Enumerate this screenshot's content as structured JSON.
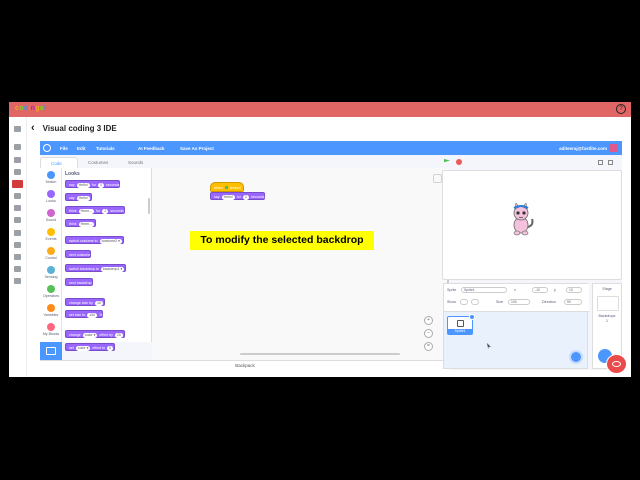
{
  "app": {
    "logo_text": "codingal",
    "logo_colors": [
      "#f5a623",
      "#7ed321",
      "#4a90e2",
      "#ff6f61",
      "#bd10e0"
    ],
    "page_title": "Visual coding 3 IDE",
    "topbar_color": "#e06666"
  },
  "menubar": {
    "items": [
      "File",
      "Edit",
      "Tutorials",
      "AI Feedback",
      "Save As Project"
    ],
    "user_email": "aditeeraj@fastlite.com",
    "accent": "#4c97ff"
  },
  "tabs": [
    "Code",
    "Costumes",
    "Sounds"
  ],
  "categories": [
    {
      "label": "Motion",
      "color": "#4c97ff"
    },
    {
      "label": "Looks",
      "color": "#9966ff"
    },
    {
      "label": "Sound",
      "color": "#cf63cf"
    },
    {
      "label": "Events",
      "color": "#ffbf00"
    },
    {
      "label": "Control",
      "color": "#ffab19"
    },
    {
      "label": "Sensing",
      "color": "#5cb1d6"
    },
    {
      "label": "Operators",
      "color": "#59c059"
    },
    {
      "label": "Variables",
      "color": "#ff8c1a"
    },
    {
      "label": "My Blocks",
      "color": "#ff6680"
    }
  ],
  "palette": {
    "title": "Looks",
    "blocks": [
      {
        "a": "say",
        "p1": "Hello!",
        "b": "for",
        "p2": "2",
        "c": "seconds"
      },
      {
        "a": "say",
        "p1": "Hello!",
        "b": "",
        "p2": "",
        "c": ""
      },
      {
        "a": "think",
        "p1": "Hmm...",
        "b": "for",
        "p2": "2",
        "c": "seconds"
      },
      {
        "a": "think",
        "p1": "Hmm...",
        "b": "",
        "p2": "",
        "c": ""
      },
      {
        "a": "switch costume to",
        "p1": "costume2 ▾",
        "b": "",
        "p2": "",
        "c": ""
      },
      {
        "a": "next costume",
        "p1": "",
        "b": "",
        "p2": "",
        "c": ""
      },
      {
        "a": "switch backdrop to",
        "p1": "backdrop1 ▾",
        "b": "",
        "p2": "",
        "c": ""
      },
      {
        "a": "next backdrop",
        "p1": "",
        "b": "",
        "p2": "",
        "c": ""
      },
      {
        "a": "change size by",
        "p1": "10",
        "b": "",
        "p2": "",
        "c": ""
      },
      {
        "a": "set size to",
        "p1": "100",
        "b": "%",
        "p2": "",
        "c": ""
      },
      {
        "a": "change",
        "p1": "color ▾",
        "b": "effect by",
        "p2": "25",
        "c": ""
      },
      {
        "a": "set",
        "p1": "color ▾",
        "b": "effect to",
        "p2": "0",
        "c": ""
      }
    ]
  },
  "script": {
    "hat_when": "when",
    "hat_clicked": "clicked",
    "say_block": {
      "a": "say",
      "p1": "Hello!",
      "b": "for",
      "p2": "2",
      "c": "seconds"
    }
  },
  "backpack_label": "Backpack",
  "sprite_info": {
    "sprite_label": "Sprite",
    "sprite_name": "Sprite1",
    "x_label": "x",
    "x_value": "-10",
    "y_label": "y",
    "y_value": "10",
    "show_label": "Show",
    "size_label": "Size",
    "size_value": "100",
    "direction_label": "Direction",
    "direction_value": "90"
  },
  "sprite_thumb_label": "Sprite1",
  "stage_panel": {
    "title": "Stage",
    "backdrops_label": "Backdrops",
    "backdrops_count": "1"
  },
  "caption": "To modify the selected backdrop"
}
